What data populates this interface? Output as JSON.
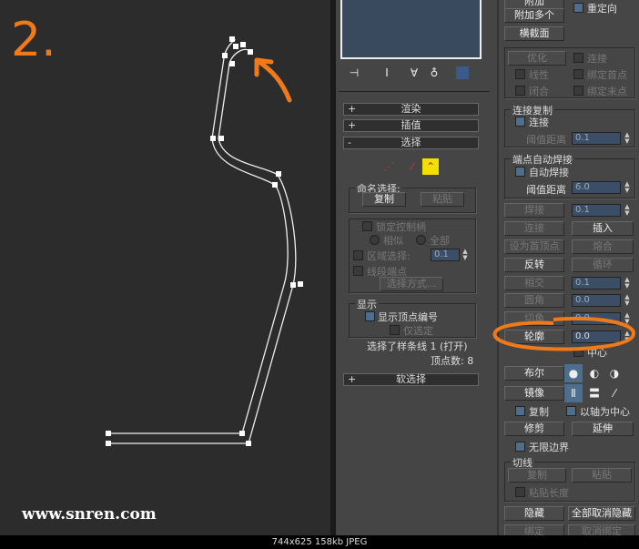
{
  "annotation": {
    "step": "2."
  },
  "watermark": "www.snren.com",
  "footer": "744x625  158kb  JPEG",
  "mid": {
    "rollouts": [
      {
        "sign": "+",
        "label": "渲染"
      },
      {
        "sign": "+",
        "label": "插值"
      },
      {
        "sign": "-",
        "label": "选择"
      }
    ],
    "named_selection": {
      "title": "命名选择:",
      "copy": "复制",
      "paste": "粘贴"
    },
    "lock_handles": "锁定控制柄",
    "similar": "相似",
    "all": "全部",
    "area_select": "区域选择:",
    "area_value": "0.1",
    "segment_end": "线段端点",
    "select_by": "选择方式...",
    "display": {
      "title": "显示",
      "show_vertex_numbers": "显示顶点编号",
      "selected_only": "仅选定"
    },
    "status": "选择了样条线 1 (打开)",
    "vertex_count": "顶点数: 8",
    "soft_selection": {
      "sign": "+",
      "label": "软选择"
    }
  },
  "right": {
    "attach": "附加",
    "reorient": "重定向",
    "attach_multiple": "附加多个",
    "cross_section": "横截面",
    "refine": "优化",
    "connect": "连接",
    "linear": "线性",
    "bind_first": "绑定首点",
    "closed": "闭合",
    "bind_last": "绑定末点",
    "connect_copy": {
      "title": "连接复制",
      "connect": "连接",
      "threshold": "阈值距离",
      "value": "0.1"
    },
    "auto_weld": {
      "title": "端点自动焊接",
      "auto_weld": "自动焊接",
      "threshold": "阈值距离",
      "value": "6.0"
    },
    "weld": "焊接",
    "weld_value": "0.1",
    "connect2": "连接",
    "insert": "插入",
    "make_first": "设为首顶点",
    "fuse": "熔合",
    "reverse": "反转",
    "cycle": "循环",
    "cross_insert": "相交",
    "cross_value": "0.1",
    "fillet": "圆角",
    "fillet_value": "0.0",
    "chamfer": "切角",
    "chamfer_value": "0.0",
    "outline": "轮廓",
    "outline_value": "0.0",
    "center": "中心",
    "boolean": "布尔",
    "mirror": "镜像",
    "copy": "复制",
    "about_pivot": "以轴为中心",
    "trim": "修剪",
    "extend": "延伸",
    "infinite_bounds": "无限边界",
    "tangent": {
      "title": "切线",
      "copy": "复制",
      "paste": "粘贴",
      "paste_length": "粘贴长度"
    },
    "hide": "隐藏",
    "unhide_all": "全部取消隐藏",
    "bind": "绑定",
    "unbind": "取消绑定"
  },
  "colors": {
    "annotation": "#f07a1a",
    "accent": "#4e6e8e"
  }
}
